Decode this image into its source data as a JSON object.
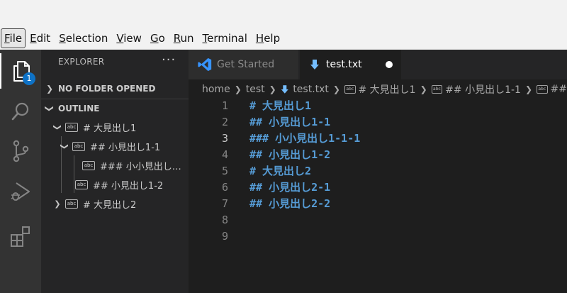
{
  "menu": {
    "items": [
      {
        "u": "F",
        "rest": "ile"
      },
      {
        "u": "E",
        "rest": "dit"
      },
      {
        "u": "S",
        "rest": "election"
      },
      {
        "u": "V",
        "rest": "iew"
      },
      {
        "u": "G",
        "rest": "o"
      },
      {
        "u": "R",
        "rest": "un"
      },
      {
        "u": "T",
        "rest": "erminal"
      },
      {
        "u": "H",
        "rest": "elp"
      }
    ]
  },
  "activity": {
    "explorer_badge": "1",
    "icons": [
      "files-icon",
      "search-icon",
      "source-control-icon",
      "run-debug-icon",
      "extensions-icon"
    ]
  },
  "sidebar": {
    "header": "EXPLORER",
    "more_actions": "···",
    "no_folder": "NO FOLDER OPENED",
    "outline": "OUTLINE",
    "abc": "abc",
    "tree": [
      {
        "label": "# 大見出し1"
      },
      {
        "label": "## 小見出し1-1"
      },
      {
        "label": "### 小小見出し…"
      },
      {
        "label": "## 小見出し1-2"
      },
      {
        "label": "# 大見出し2"
      }
    ]
  },
  "tabs": {
    "inactive": "Get Started",
    "active": "test.txt"
  },
  "breadcrumb": {
    "home": "home",
    "folder": "test",
    "file": "test.txt",
    "sym1": "# 大見出し1",
    "sym2": "## 小見出し1-1",
    "sym3": "##"
  },
  "editor": {
    "current_line": 3,
    "lines": [
      {
        "n": "1",
        "text": "# 大見出し1"
      },
      {
        "n": "2",
        "text": "## 小見出し1-1"
      },
      {
        "n": "3",
        "text": "### 小小見出し1-1-1"
      },
      {
        "n": "4",
        "text": "## 小見出し1-2"
      },
      {
        "n": "5",
        "text": "# 大見出し2"
      },
      {
        "n": "6",
        "text": "## 小見出し2-1"
      },
      {
        "n": "7",
        "text": "## 小見出し2-2"
      },
      {
        "n": "8",
        "text": ""
      },
      {
        "n": "9",
        "text": ""
      }
    ]
  },
  "colors": {
    "accent": "#0e72c6",
    "heading": "#569cd6",
    "vscode_blue": "#3794ff"
  }
}
